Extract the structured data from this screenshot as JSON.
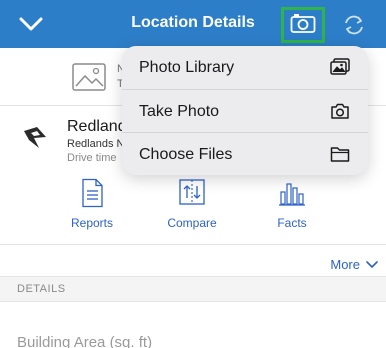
{
  "header": {
    "title": "Location Details",
    "back_icon": "chevron-down-icon",
    "camera_icon": "camera-icon",
    "refresh_icon": "refresh-icon",
    "bg_color": "#2d7ec8",
    "highlight_color": "#2fb34a"
  },
  "photo": {
    "caption_line1": "N",
    "caption_line2": "T"
  },
  "location": {
    "name": "Redlands",
    "subtitle": "Redlands N",
    "drive_time": "Drive time"
  },
  "actions": [
    {
      "label": "Reports",
      "icon": "report-icon"
    },
    {
      "label": "Compare",
      "icon": "compare-icon"
    },
    {
      "label": "Facts",
      "icon": "bar-chart-icon"
    }
  ],
  "more": {
    "label": "More"
  },
  "details": {
    "header": "DETAILS",
    "building_area_label": "Building Area (sq. ft)"
  },
  "menu": {
    "items": [
      {
        "label": "Photo Library",
        "icon": "photo-library-icon"
      },
      {
        "label": "Take Photo",
        "icon": "camera-icon"
      },
      {
        "label": "Choose Files",
        "icon": "folder-icon"
      }
    ]
  },
  "colors": {
    "link": "#2d62c9"
  }
}
